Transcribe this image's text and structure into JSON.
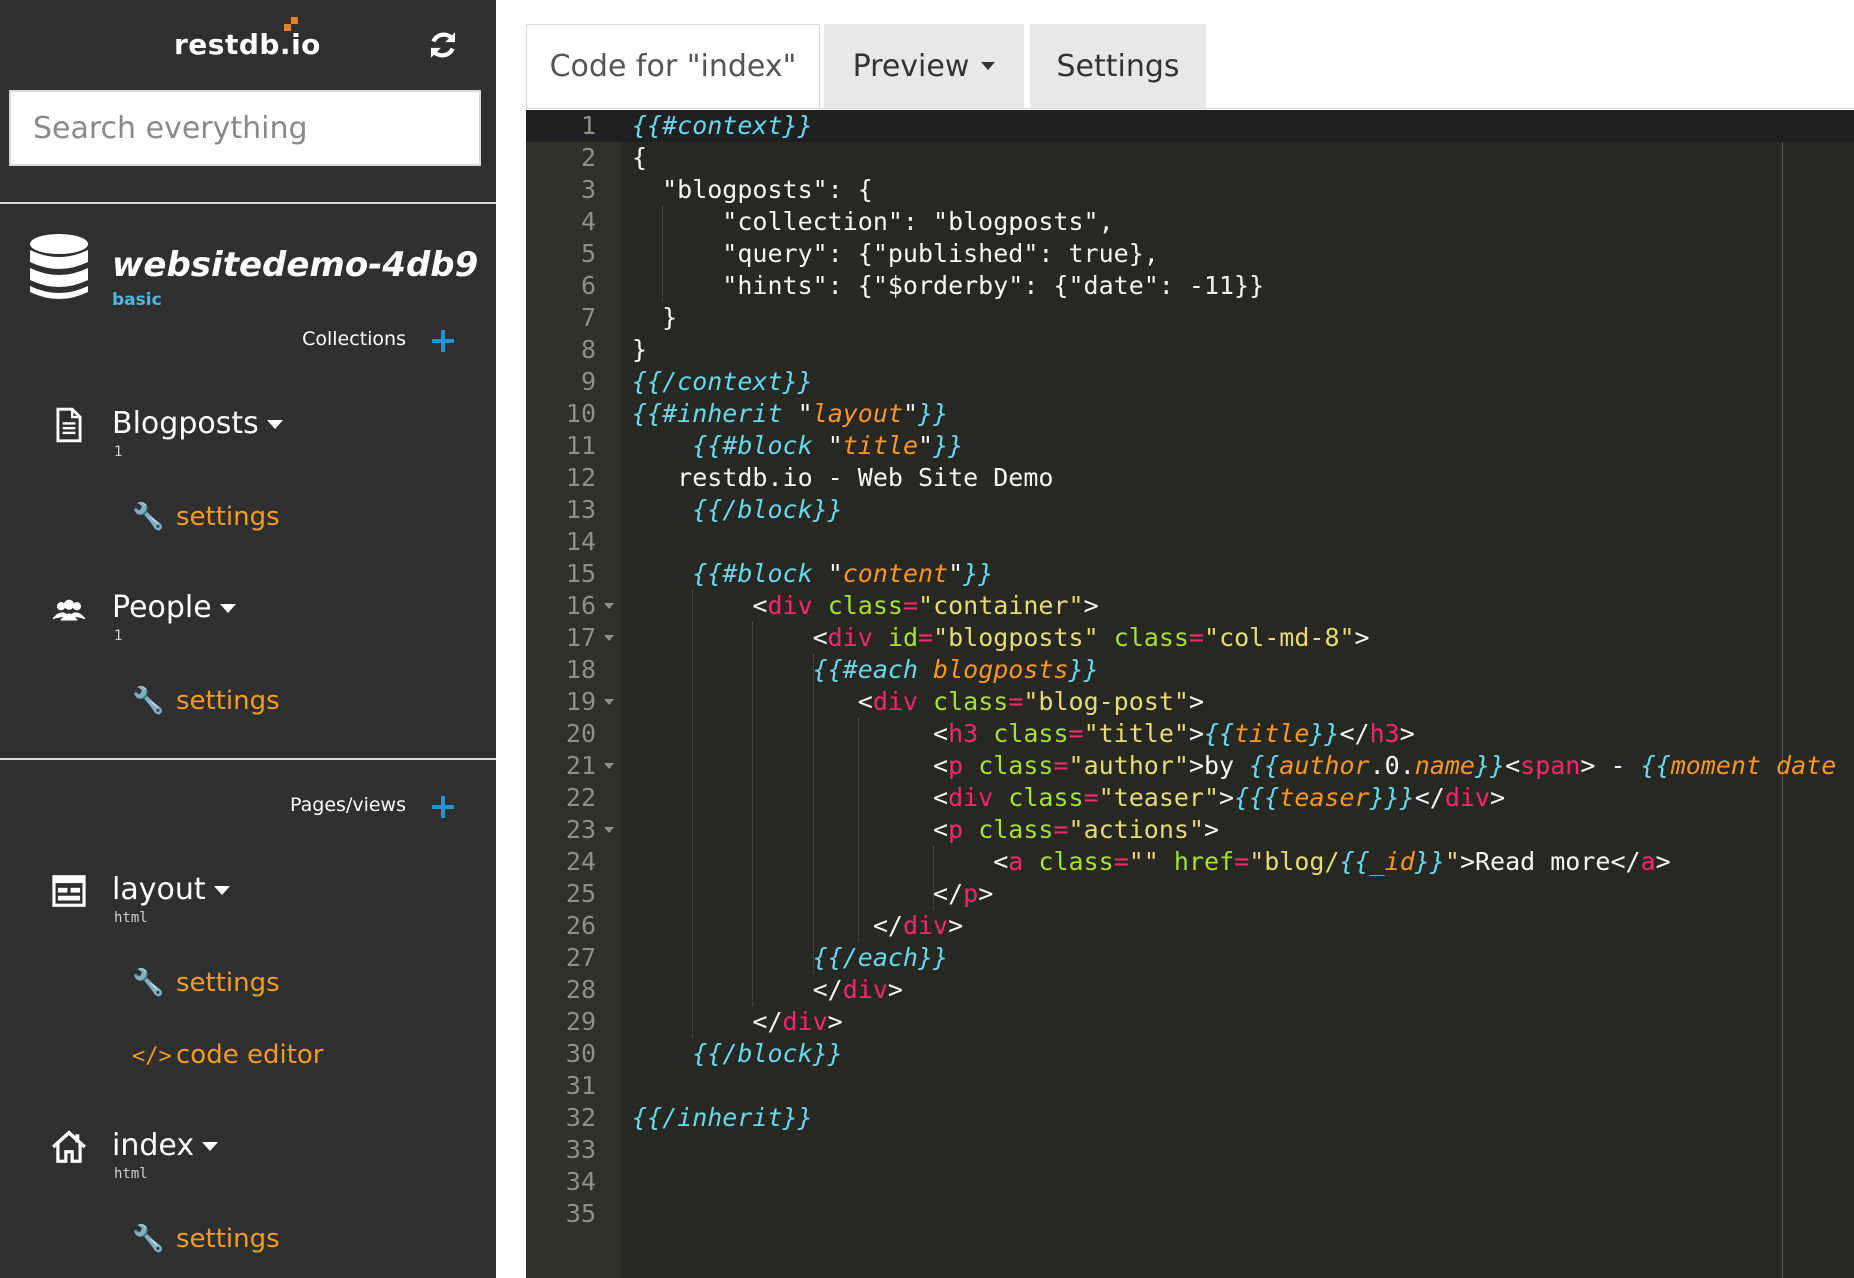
{
  "brand": {
    "name": "restdb.io"
  },
  "search": {
    "placeholder": "Search everything"
  },
  "database": {
    "name": "websitedemo-4db9",
    "plan": "basic"
  },
  "sidebar": {
    "collections_heading": "Collections",
    "collections": [
      {
        "label": "Blogposts",
        "count": "1",
        "icon": "document-icon",
        "settings": "settings"
      },
      {
        "label": "People",
        "count": "1",
        "icon": "users-icon",
        "settings": "settings"
      }
    ],
    "pages_heading": "Pages/views",
    "pages": [
      {
        "label": "layout",
        "type": "html",
        "icon": "layout-icon",
        "settings": "settings",
        "code_editor": "code editor"
      },
      {
        "label": "index",
        "type": "html",
        "icon": "home-icon",
        "settings": "settings"
      }
    ]
  },
  "tabs": [
    {
      "label": "Code for \"index\"",
      "active": true
    },
    {
      "label": "Preview",
      "dropdown": true
    },
    {
      "label": "Settings"
    }
  ],
  "colors": {
    "sidebar_bg": "#2f2f2f",
    "accent_orange": "#f39c1f",
    "accent_blue": "#1e96d6",
    "editor_bg": "#272822"
  },
  "editor": {
    "lines": [
      [
        [
          "h",
          "{{#context}}"
        ]
      ],
      [
        [
          "p",
          "{"
        ]
      ],
      [
        [
          "p",
          "  \"blogposts\": {"
        ]
      ],
      [
        [
          "p",
          "      \"collection\": \"blogposts\","
        ]
      ],
      [
        [
          "p",
          "      \"query\": {\"published\": true},"
        ]
      ],
      [
        [
          "p",
          "      \"hints\": {\"$orderby\": {\"date\": -11}}"
        ]
      ],
      [
        [
          "p",
          "  }"
        ]
      ],
      [
        [
          "p",
          "}"
        ]
      ],
      [
        [
          "h",
          "{{/context}}"
        ]
      ],
      [
        [
          "h",
          "{{#inherit "
        ],
        [
          "p",
          "\""
        ],
        [
          "o",
          "layout"
        ],
        [
          "p",
          "\""
        ],
        [
          "h",
          "}}"
        ]
      ],
      [
        [
          "p",
          "    "
        ],
        [
          "h",
          "{{#block "
        ],
        [
          "p",
          "\""
        ],
        [
          "o",
          "title"
        ],
        [
          "p",
          "\""
        ],
        [
          "h",
          "}}"
        ]
      ],
      [
        [
          "p",
          "   restdb.io - Web Site Demo"
        ]
      ],
      [
        [
          "p",
          "    "
        ],
        [
          "h",
          "{{/block}}"
        ]
      ],
      [
        [
          "p",
          ""
        ]
      ],
      [
        [
          "p",
          "    "
        ],
        [
          "h",
          "{{#block "
        ],
        [
          "p",
          "\""
        ],
        [
          "o",
          "content"
        ],
        [
          "p",
          "\""
        ],
        [
          "h",
          "}}"
        ]
      ],
      [
        [
          "p",
          "        <"
        ],
        [
          "t",
          "div"
        ],
        [
          "p",
          " "
        ],
        [
          "a",
          "class"
        ],
        [
          "t",
          "="
        ],
        [
          "s",
          "\"container\""
        ],
        [
          "p",
          ">"
        ]
      ],
      [
        [
          "p",
          "            <"
        ],
        [
          "t",
          "div"
        ],
        [
          "p",
          " "
        ],
        [
          "a",
          "id"
        ],
        [
          "t",
          "="
        ],
        [
          "s",
          "\"blogposts\""
        ],
        [
          "p",
          " "
        ],
        [
          "a",
          "class"
        ],
        [
          "t",
          "="
        ],
        [
          "s",
          "\"col-md-8\""
        ],
        [
          "p",
          ">"
        ]
      ],
      [
        [
          "p",
          "            "
        ],
        [
          "h",
          "{{#each "
        ],
        [
          "o",
          "blogposts"
        ],
        [
          "h",
          "}}"
        ]
      ],
      [
        [
          "p",
          "               <"
        ],
        [
          "t",
          "div"
        ],
        [
          "p",
          " "
        ],
        [
          "a",
          "class"
        ],
        [
          "t",
          "="
        ],
        [
          "s",
          "\"blog-post\""
        ],
        [
          "p",
          ">"
        ]
      ],
      [
        [
          "p",
          "                    <"
        ],
        [
          "t",
          "h3"
        ],
        [
          "p",
          " "
        ],
        [
          "a",
          "class"
        ],
        [
          "t",
          "="
        ],
        [
          "s",
          "\"title\""
        ],
        [
          "p",
          ">"
        ],
        [
          "h",
          "{{"
        ],
        [
          "o",
          "title"
        ],
        [
          "h",
          "}}"
        ],
        [
          "p",
          "</"
        ],
        [
          "t",
          "h3"
        ],
        [
          "p",
          ">"
        ]
      ],
      [
        [
          "p",
          "                    <"
        ],
        [
          "t",
          "p"
        ],
        [
          "p",
          " "
        ],
        [
          "a",
          "class"
        ],
        [
          "t",
          "="
        ],
        [
          "s",
          "\"author\""
        ],
        [
          "p",
          ">by "
        ],
        [
          "h",
          "{{"
        ],
        [
          "o",
          "author"
        ],
        [
          "p",
          ".0."
        ],
        [
          "o",
          "name"
        ],
        [
          "h",
          "}}"
        ],
        [
          "p",
          "<"
        ],
        [
          "t",
          "span"
        ],
        [
          "p",
          "> - "
        ],
        [
          "h",
          "{{"
        ],
        [
          "o",
          "moment date form"
        ]
      ],
      [
        [
          "p",
          "                    <"
        ],
        [
          "t",
          "div"
        ],
        [
          "p",
          " "
        ],
        [
          "a",
          "class"
        ],
        [
          "t",
          "="
        ],
        [
          "s",
          "\"teaser\""
        ],
        [
          "p",
          ">"
        ],
        [
          "h",
          "{{{"
        ],
        [
          "o",
          "teaser"
        ],
        [
          "h",
          "}}}"
        ],
        [
          "p",
          "</"
        ],
        [
          "t",
          "div"
        ],
        [
          "p",
          ">"
        ]
      ],
      [
        [
          "p",
          "                    <"
        ],
        [
          "t",
          "p"
        ],
        [
          "p",
          " "
        ],
        [
          "a",
          "class"
        ],
        [
          "t",
          "="
        ],
        [
          "s",
          "\"actions\""
        ],
        [
          "p",
          ">"
        ]
      ],
      [
        [
          "p",
          "                        <"
        ],
        [
          "t",
          "a"
        ],
        [
          "p",
          " "
        ],
        [
          "a",
          "class"
        ],
        [
          "t",
          "="
        ],
        [
          "s",
          "\"\""
        ],
        [
          "p",
          " "
        ],
        [
          "a",
          "href"
        ],
        [
          "t",
          "="
        ],
        [
          "s",
          "\"blog/"
        ],
        [
          "h",
          "{{"
        ],
        [
          "o",
          "_id"
        ],
        [
          "h",
          "}}"
        ],
        [
          "s",
          "\""
        ],
        [
          "p",
          ">Read more</"
        ],
        [
          "t",
          "a"
        ],
        [
          "p",
          ">"
        ]
      ],
      [
        [
          "p",
          "                    </"
        ],
        [
          "t",
          "p"
        ],
        [
          "p",
          ">"
        ]
      ],
      [
        [
          "p",
          "                </"
        ],
        [
          "t",
          "div"
        ],
        [
          "p",
          ">"
        ]
      ],
      [
        [
          "p",
          "            "
        ],
        [
          "h",
          "{{/each}}"
        ]
      ],
      [
        [
          "p",
          "            </"
        ],
        [
          "t",
          "div"
        ],
        [
          "p",
          ">"
        ]
      ],
      [
        [
          "p",
          "        </"
        ],
        [
          "t",
          "div"
        ],
        [
          "p",
          ">"
        ]
      ],
      [
        [
          "p",
          "    "
        ],
        [
          "h",
          "{{/block}}"
        ]
      ],
      [
        [
          "p",
          ""
        ]
      ],
      [
        [
          "h",
          "{{/inherit}}"
        ]
      ],
      [
        [
          "p",
          ""
        ]
      ],
      [
        [
          "p",
          ""
        ]
      ],
      [
        [
          "p",
          ""
        ]
      ]
    ],
    "folded_lines": [
      16,
      17,
      19,
      21,
      23
    ]
  }
}
